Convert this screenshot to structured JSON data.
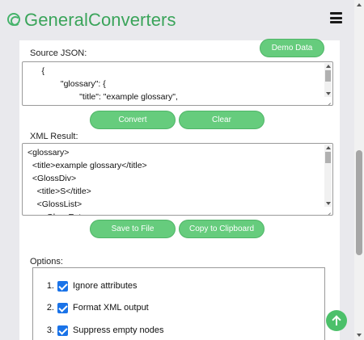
{
  "header": {
    "brand": "GeneralConverters"
  },
  "source": {
    "label": "Source JSON:",
    "demo_label": "Demo Data",
    "text": "      {\n              \"glossary\": {\n                      \"title\": \"example glossary\",\n                      \"GlossDiv\": {"
  },
  "actions1": {
    "convert_label": "Convert",
    "clear_label": "Clear"
  },
  "result": {
    "label": "XML Result:",
    "text": "<glossary>\n  <title>example glossary</title>\n  <GlossDiv>\n    <title>S</title>\n    <GlossList>\n      <GlossEntry>"
  },
  "actions2": {
    "save_label": "Save to File",
    "copy_label": "Copy to Clipboard"
  },
  "options": {
    "label": "Options:",
    "items": [
      {
        "num": "1.",
        "label": "Ignore attributes",
        "checked": true
      },
      {
        "num": "2.",
        "label": "Format XML output",
        "checked": true
      },
      {
        "num": "3.",
        "label": "Suppress empty nodes",
        "checked": true
      }
    ]
  },
  "colors": {
    "brand": "#3aa45a",
    "button": "#66cc7d",
    "checkbox": "#1a73e8"
  }
}
